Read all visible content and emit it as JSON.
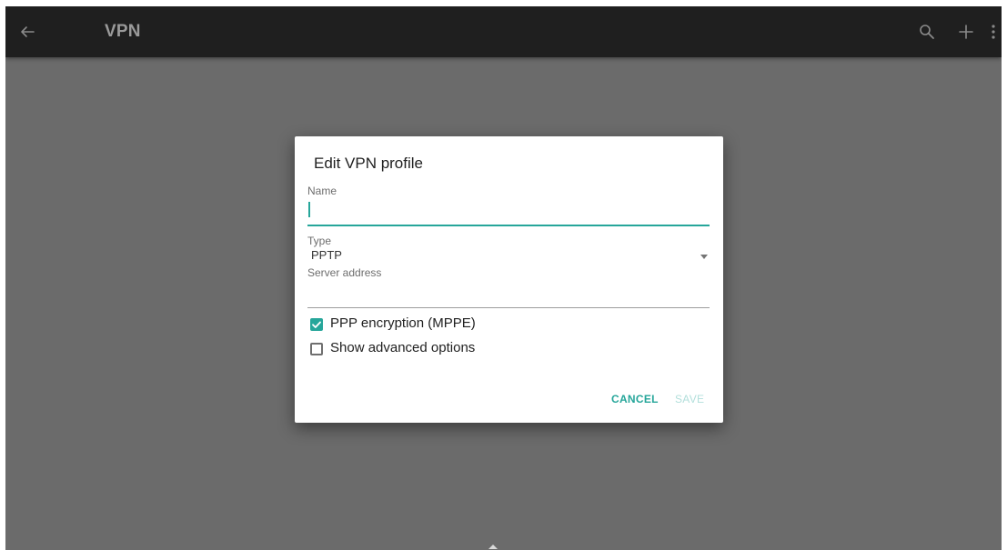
{
  "app": {
    "title": "VPN"
  },
  "toolbar": {
    "back_icon": "arrow-back-icon",
    "search_icon": "search-icon",
    "add_icon": "plus-icon",
    "more_icon": "more-vert-icon"
  },
  "dialog": {
    "title": "Edit VPN profile",
    "name": {
      "label": "Name",
      "value": ""
    },
    "type": {
      "label": "Type",
      "selected": "PPTP"
    },
    "server": {
      "label": "Server address",
      "value": ""
    },
    "ppp_encryption": {
      "label": "PPP encryption (MPPE)",
      "checked": true
    },
    "advanced": {
      "label": "Show advanced options",
      "checked": false
    },
    "cancel_label": "CANCEL",
    "save_label": "SAVE"
  },
  "colors": {
    "accent": "#26a69a",
    "toolbar_bg": "#1f1f1f",
    "scrim": "#6b6b6b",
    "disabled": "#b2dfdb"
  }
}
